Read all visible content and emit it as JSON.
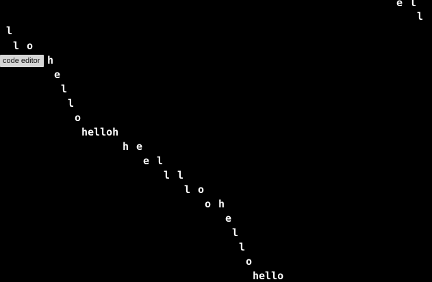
{
  "canvas": {
    "background": "#000000",
    "text_color": "#ffffff",
    "cells": [
      "e",
      "l",
      "l",
      "l",
      "l",
      "o",
      "h",
      "e",
      "l",
      "l",
      "o",
      "helloh",
      "h",
      "e",
      "e",
      "l",
      "l",
      "l",
      "l",
      "o",
      "o",
      "h",
      "e",
      "l",
      "l",
      "o",
      "hello"
    ]
  },
  "tooltip": {
    "label": "code editor"
  }
}
